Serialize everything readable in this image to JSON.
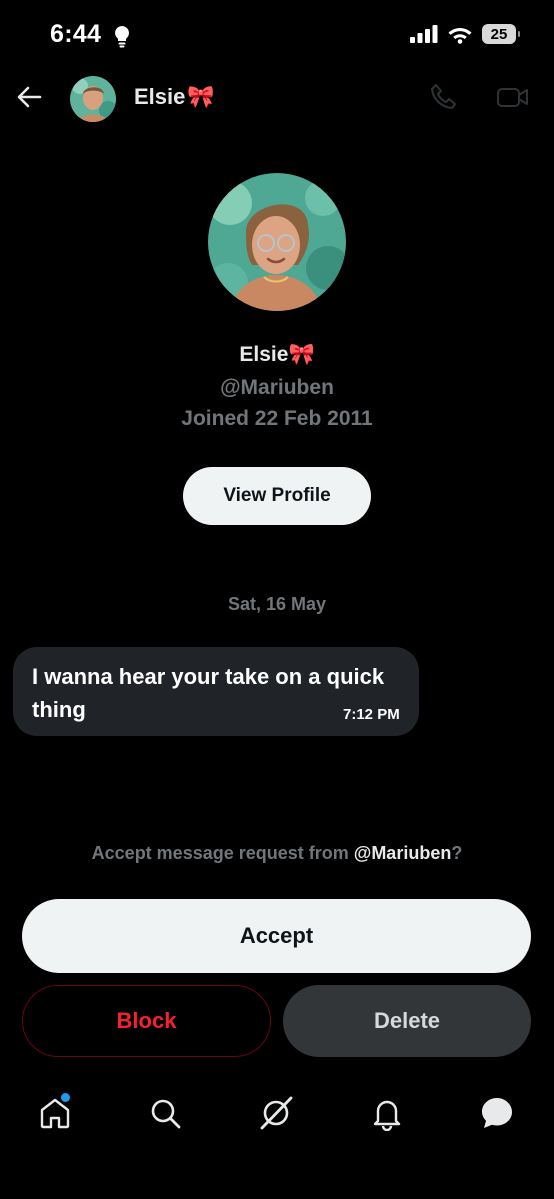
{
  "status_bar": {
    "time": "6:44",
    "battery": "25"
  },
  "header": {
    "name": "Elsie",
    "name_emoji": "🎀"
  },
  "profile": {
    "name": "Elsie",
    "name_emoji": "🎀",
    "handle": "@Mariuben",
    "joined": "Joined 22 Feb 2011",
    "view_profile_label": "View Profile"
  },
  "conversation": {
    "date": "Sat, 16 May",
    "messages": [
      {
        "text": "I wanna hear your take on a quick thing",
        "time": "7:12 PM"
      }
    ]
  },
  "request": {
    "prefix": "Accept message request from ",
    "handle": "@Mariuben",
    "suffix": "?",
    "accept_label": "Accept",
    "block_label": "Block",
    "delete_label": "Delete"
  },
  "colors": {
    "background": "#000000",
    "accent_blue": "#1d9bf0",
    "block_red": "#f4212e",
    "muted_text": "#71767b"
  },
  "bottom_nav": [
    "home-icon",
    "search-icon",
    "grok-icon",
    "notifications-icon",
    "messages-icon"
  ]
}
